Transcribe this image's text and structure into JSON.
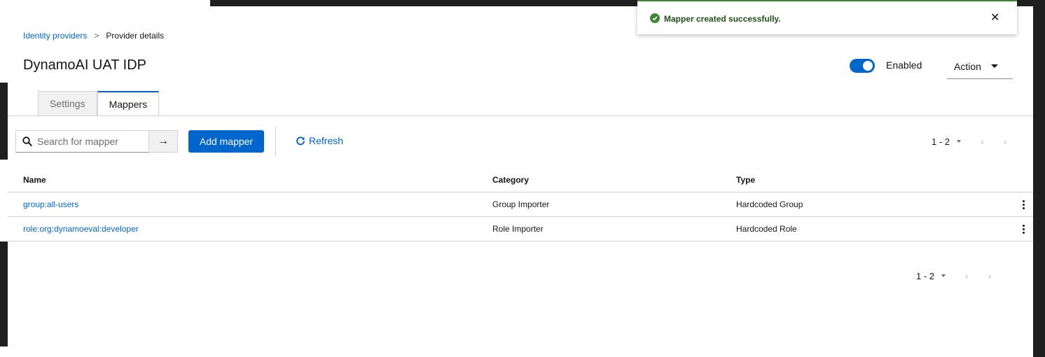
{
  "breadcrumb": {
    "parent": "Identity providers",
    "separator": ">",
    "current": "Provider details"
  },
  "page": {
    "title": "DynamoAI UAT IDP",
    "enabled_label": "Enabled",
    "enabled": true,
    "action_label": "Action"
  },
  "tabs": [
    {
      "label": "Settings",
      "active": false
    },
    {
      "label": "Mappers",
      "active": true
    }
  ],
  "toolbar": {
    "search_placeholder": "Search for mapper",
    "search_go_glyph": "→",
    "add_label": "Add mapper",
    "refresh_label": "Refresh"
  },
  "pagination": {
    "top": {
      "range": "1 - 2",
      "prev": "‹",
      "next": "›"
    },
    "bottom": {
      "range": "1 - 2",
      "prev": "‹",
      "next": "›"
    }
  },
  "table": {
    "columns": [
      "Name",
      "Category",
      "Type"
    ],
    "rows": [
      {
        "name": "group:all-users",
        "category": "Group Importer",
        "type": "Hardcoded Group"
      },
      {
        "name": "role:org:dynamoeval:developer",
        "category": "Role Importer",
        "type": "Hardcoded Role"
      }
    ]
  },
  "toast": {
    "message": "Mapper created successfully.",
    "close_glyph": "✕",
    "color": "#3e8635"
  },
  "colors": {
    "accent": "#0066cc",
    "success": "#3e8635"
  }
}
